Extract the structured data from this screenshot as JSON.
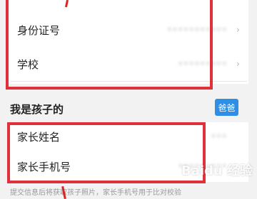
{
  "form": {
    "id_card_label": "身份证号",
    "id_card_value": "•••••••••••",
    "school_label": "学校",
    "school_value": "•••••••••",
    "chevron": "›"
  },
  "child_section": {
    "title": "我是孩子的",
    "relation_button": "爸爸"
  },
  "parent": {
    "name_label": "家长姓名",
    "name_value": "•••",
    "phone_label": "家长手机号",
    "phone_value": "•••••••••"
  },
  "hint": "提交信息后将获取孩子照片，家长手机号用于比对校验",
  "watermark": "Baidu 经验",
  "colors": {
    "highlight": "#e0303a",
    "accent": "#2f8fe6"
  }
}
